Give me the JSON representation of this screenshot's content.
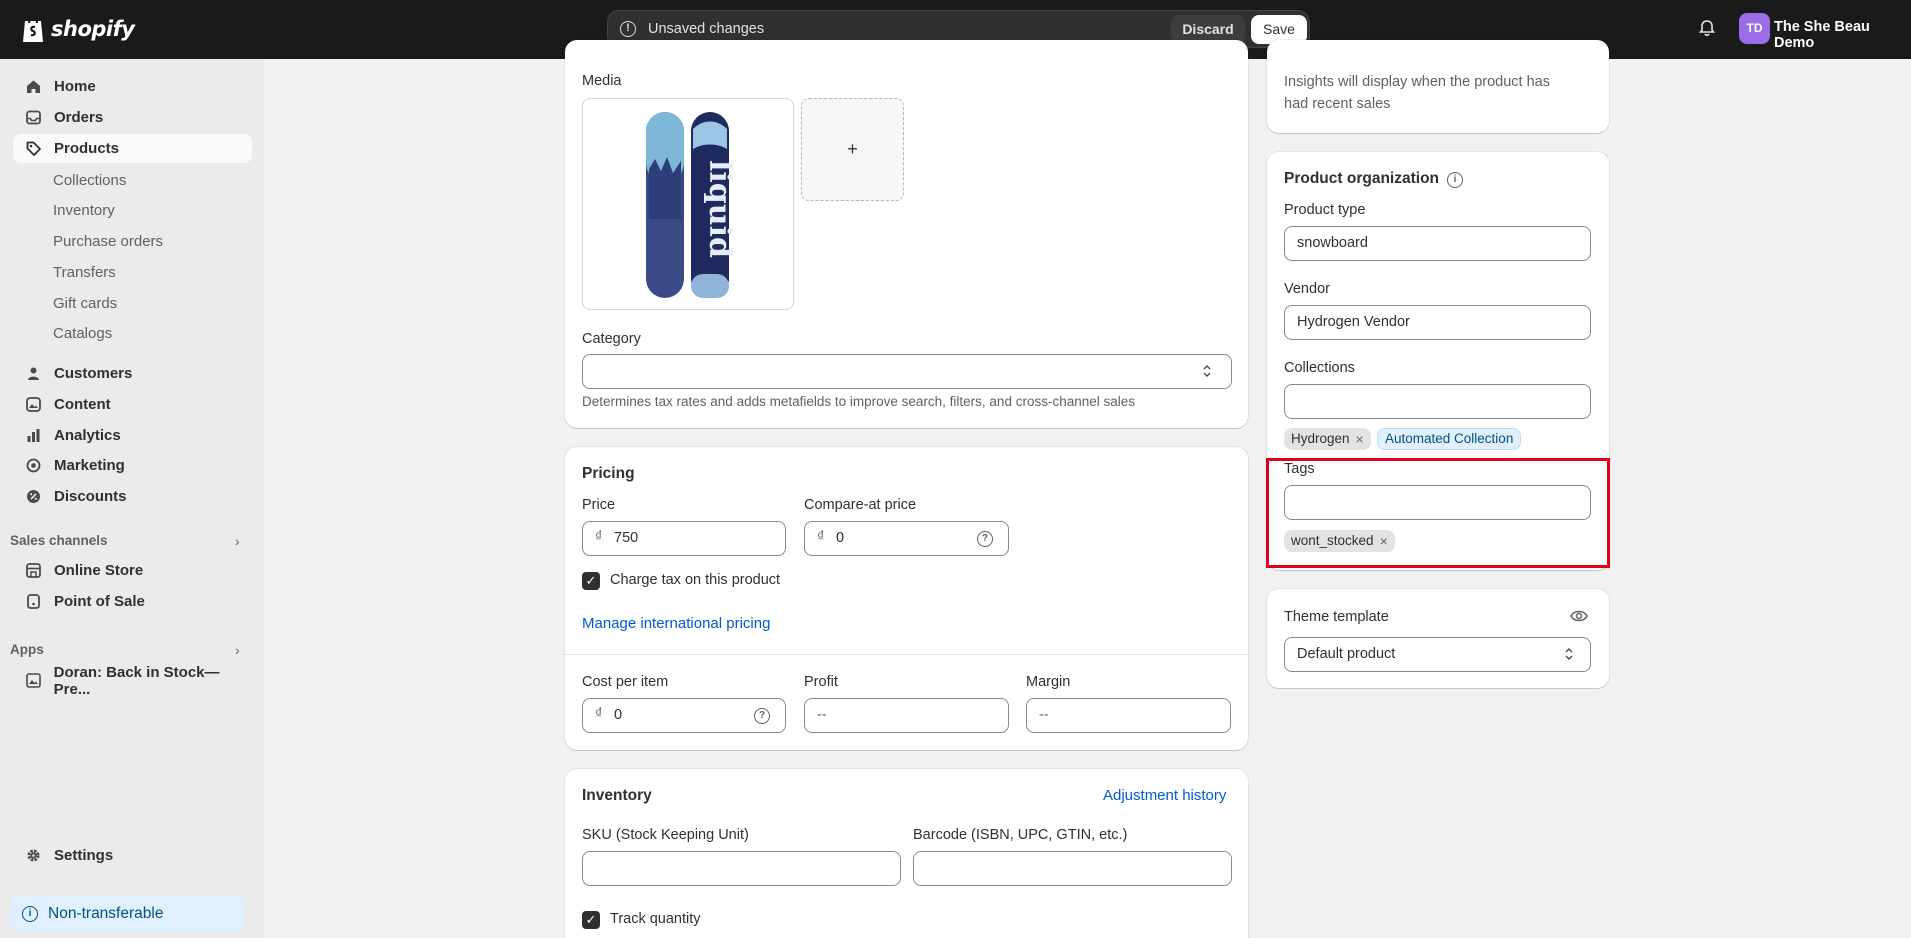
{
  "topbar": {
    "logo_text": "shopify",
    "unsaved_text": "Unsaved changes",
    "discard_label": "Discard",
    "save_label": "Save",
    "avatar_initials": "TD",
    "store_name": "The She Beau Demo"
  },
  "sidebar": {
    "items": [
      {
        "label": "Home",
        "icon": "home-icon"
      },
      {
        "label": "Orders",
        "icon": "inbox-icon"
      },
      {
        "label": "Products",
        "icon": "tag-icon",
        "active": true
      }
    ],
    "product_subitems": [
      "Collections",
      "Inventory",
      "Purchase orders",
      "Transfers",
      "Gift cards",
      "Catalogs"
    ],
    "items2": [
      {
        "label": "Customers",
        "icon": "person-icon"
      },
      {
        "label": "Content",
        "icon": "content-icon"
      },
      {
        "label": "Analytics",
        "icon": "chart-icon"
      },
      {
        "label": "Marketing",
        "icon": "target-icon"
      },
      {
        "label": "Discounts",
        "icon": "discount-icon"
      }
    ],
    "sales_channels_label": "Sales channels",
    "channels": [
      {
        "label": "Online Store",
        "icon": "store-icon"
      },
      {
        "label": "Point of Sale",
        "icon": "pos-icon"
      }
    ],
    "apps_label": "Apps",
    "apps": [
      {
        "label": "Doran: Back in Stock—Pre...",
        "icon": "image-icon"
      }
    ],
    "settings_label": "Settings",
    "nontransferable_label": "Non-transferable"
  },
  "main": {
    "media_label": "Media",
    "add_media_symbol": "+",
    "category_label": "Category",
    "category_value": "",
    "category_help": "Determines tax rates and adds metafields to improve search, filters, and cross-channel sales",
    "pricing": {
      "title": "Pricing",
      "price_label": "Price",
      "price_currency": "₫",
      "price_value": "750",
      "compare_label": "Compare-at price",
      "compare_value": "0",
      "charge_tax_label": "Charge tax on this product",
      "charge_tax_checked": true,
      "manage_intl_label": "Manage international pricing",
      "cost_label": "Cost per item",
      "cost_value": "0",
      "profit_label": "Profit",
      "profit_value": "--",
      "margin_label": "Margin",
      "margin_value": "--"
    },
    "inventory": {
      "title": "Inventory",
      "adjustment_history_label": "Adjustment history",
      "sku_label": "SKU (Stock Keeping Unit)",
      "sku_value": "",
      "barcode_label": "Barcode (ISBN, UPC, GTIN, etc.)",
      "barcode_value": "",
      "track_quantity_label": "Track quantity",
      "track_quantity_checked": true
    }
  },
  "right": {
    "insights_text": "Insights will display when the product has had recent sales",
    "org": {
      "title": "Product organization",
      "product_type_label": "Product type",
      "product_type_value": "snowboard",
      "vendor_label": "Vendor",
      "vendor_value": "Hydrogen Vendor",
      "collections_label": "Collections",
      "collections_value": "",
      "collection_tags": [
        "Hydrogen",
        "Automated Collection"
      ],
      "tags_label": "Tags",
      "tags_value": "",
      "tags": [
        "wont_stocked"
      ]
    },
    "theme": {
      "title": "Theme template",
      "value": "Default product"
    }
  },
  "colors": {
    "topbar_bg": "#1a1a1a",
    "link": "#005bd3",
    "highlight": "#e0001b",
    "avatar": "#9a6ce8"
  }
}
